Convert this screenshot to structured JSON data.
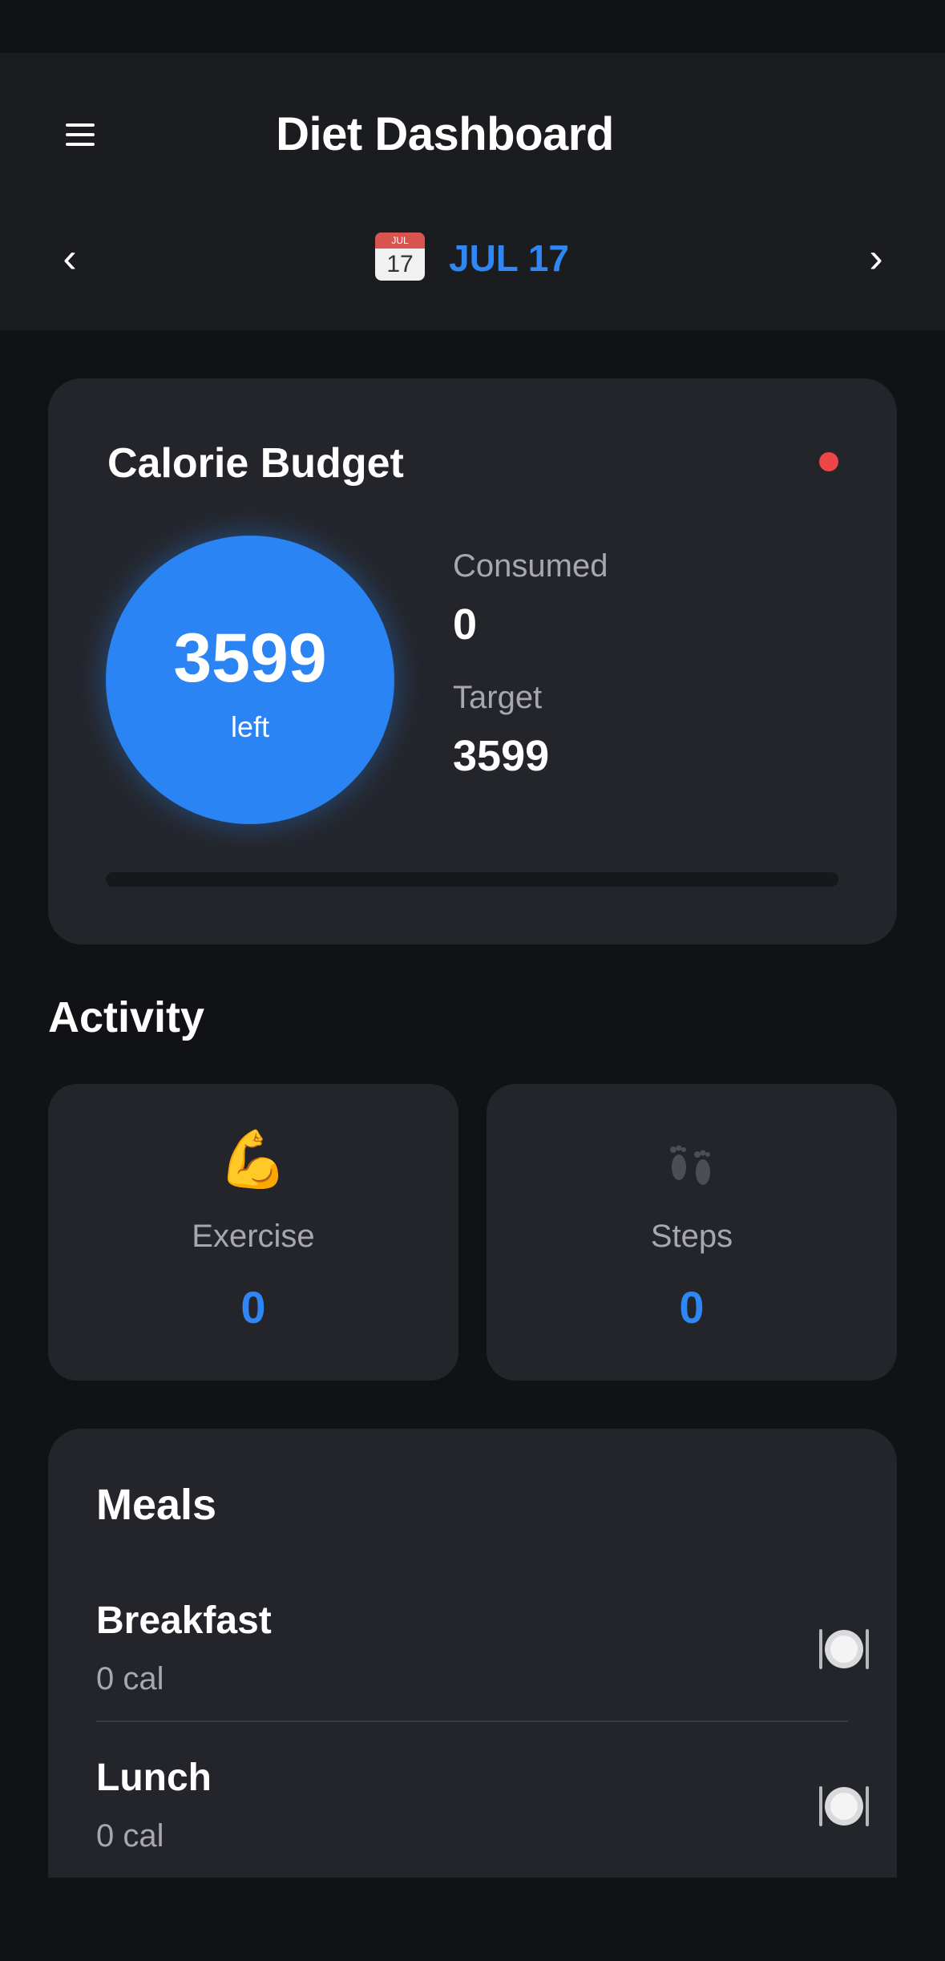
{
  "header": {
    "title": "Diet Dashboard",
    "prev_label": "‹",
    "next_label": "›",
    "date_icon_month": "JUL",
    "date_icon_day": "17",
    "date_label": "JUL 17"
  },
  "budget": {
    "title": "Calorie Budget",
    "remaining": "3599",
    "remaining_label": "left",
    "consumed_label": "Consumed",
    "consumed_value": "0",
    "target_label": "Target",
    "target_value": "3599",
    "progress_fraction": 0,
    "status_color": "#ec4646"
  },
  "activity": {
    "title": "Activity",
    "exercise": {
      "icon": "flexed-biceps-icon",
      "label": "Exercise",
      "value": "0"
    },
    "steps": {
      "icon": "footprints-icon",
      "label": "Steps",
      "value": "0"
    }
  },
  "meals": {
    "title": "Meals",
    "items": [
      {
        "name": "Breakfast",
        "calories": "0 cal",
        "icon": "plate-cutlery-icon"
      },
      {
        "name": "Lunch",
        "calories": "0 cal",
        "icon": "plate-cutlery-icon"
      }
    ]
  },
  "colors": {
    "accent": "#2f86f5",
    "background": "#111216",
    "card": "#24252a"
  }
}
